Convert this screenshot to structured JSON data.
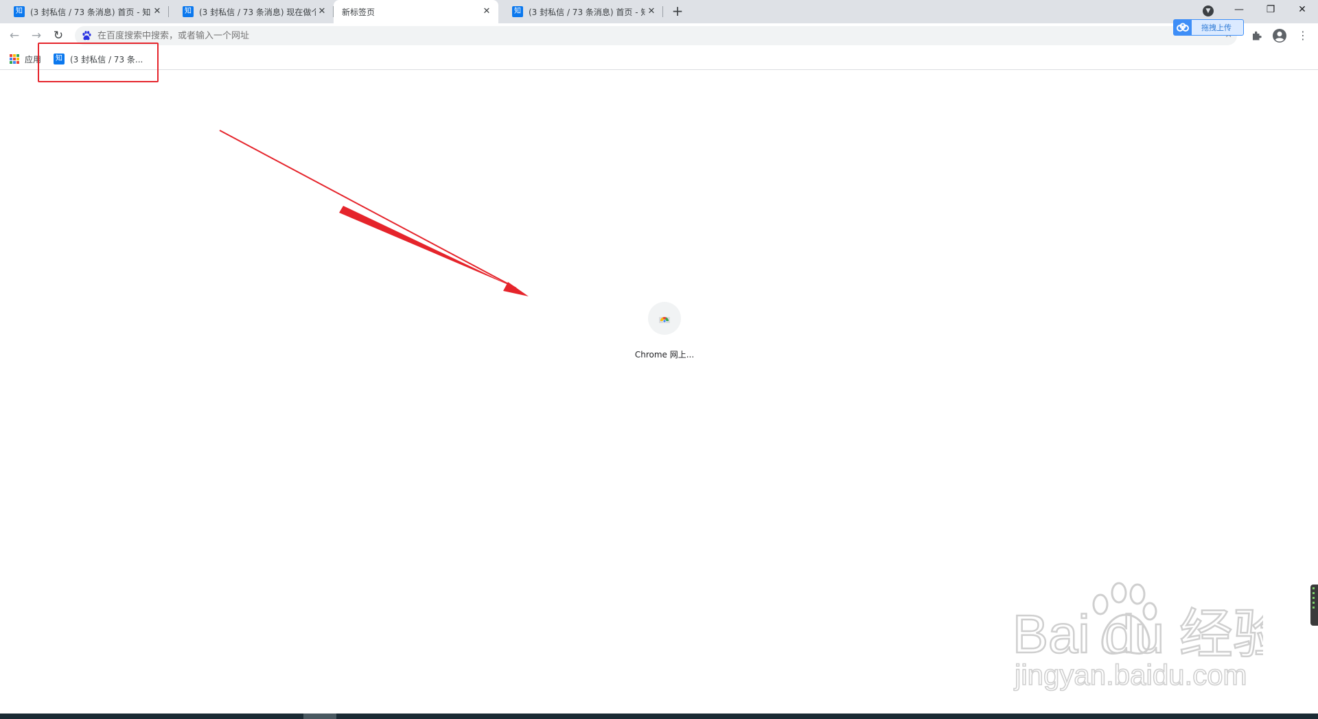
{
  "tabs": [
    {
      "label": "(3 封私信 / 73 条消息) 首页 - 知",
      "favicon": "知",
      "active": false
    },
    {
      "label": "(3 封私信 / 73 条消息) 现在做个",
      "favicon": "知",
      "active": false
    },
    {
      "label": "新标签页",
      "favicon": "",
      "active": true
    },
    {
      "label": "(3 封私信 / 73 条消息) 首页 - 知",
      "favicon": "知",
      "active": false
    }
  ],
  "tab_close_glyph": "✕",
  "new_tab_glyph": "+",
  "window": {
    "minimize": "—",
    "restore": "❐",
    "close": "✕"
  },
  "toolbar": {
    "back_glyph": "←",
    "forward_glyph": "→",
    "reload_glyph": "↻",
    "omnibox_placeholder": "在百度搜索中搜索，或者输入一个网址",
    "star_glyph": "☆",
    "menu_glyph": "⋮",
    "upload_label": "拖拽上传"
  },
  "bookmarks": {
    "apps_label": "应用",
    "items": [
      {
        "label": "(3 封私信 / 73 条...",
        "favicon": "知"
      }
    ]
  },
  "shortcut": {
    "label": "Chrome 网上..."
  },
  "watermark": {
    "brand": "Bai du 经验",
    "url": "jingyan.baidu.com"
  },
  "colors": {
    "annotation_red": "#e5242b",
    "zhihu_blue": "#0b78ee",
    "tabstrip": "#dee1e6",
    "omnibox": "#f1f3f4",
    "baidu_blue": "#3e8ef7"
  }
}
